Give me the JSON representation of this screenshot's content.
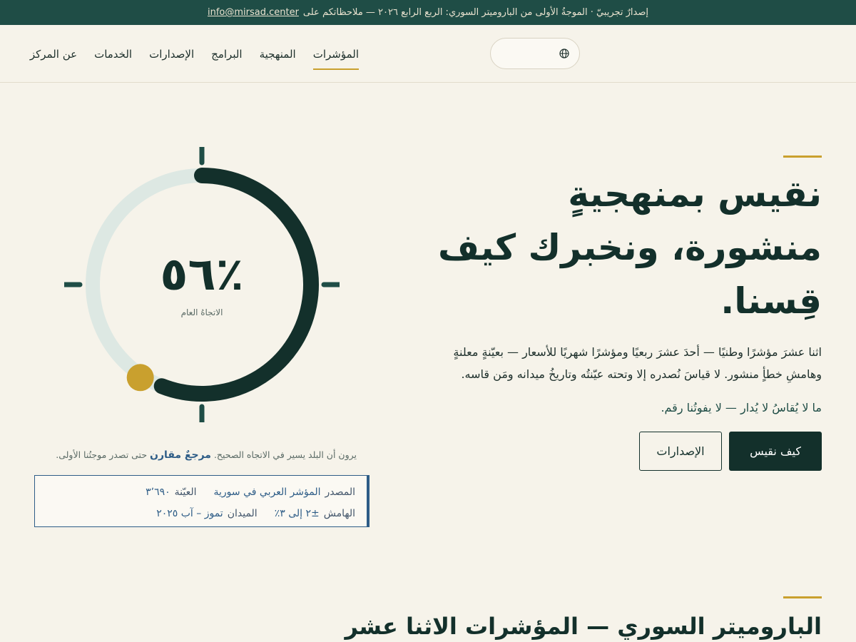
{
  "topbar": {
    "notice": "إصدارٌ تجريبيّ · الموجةُ الأولى من الباروميتر السوري: الربع الرابع ٢٠٢٦ — ملاحظاتكم على",
    "email": "info@mirsad.center"
  },
  "nav": {
    "items": [
      {
        "label": "المؤشرات",
        "active": true
      },
      {
        "label": "المنهجية"
      },
      {
        "label": "البرامج"
      },
      {
        "label": "الإصدارات"
      },
      {
        "label": "الخدمات"
      },
      {
        "label": "عن المركز"
      }
    ],
    "language_icon": "globe-icon"
  },
  "hero": {
    "title_line1": "نقيس بمنهجيةٍ",
    "title_line2": "منشورة، ونخبرك كيف",
    "title_line3": "قِسنا.",
    "paragraph_line1": "اثنا عشرَ مؤشرًا وطنيًا — أحدَ عشرَ ربعيًا ومؤشرًا شهريًا للأسعار — بعيّنةٍ معلنةٍ",
    "paragraph_line2": "وهامشِ خطأٍ منشور. لا قياسَ نُصدره إلا وتحته عيّنتُه وتاريخُ ميدانه ومَن قاسه.",
    "tagline": "ما لا يُقاسُ لا يُدار — لا يفوتُنا رقم.",
    "primary_button": "كيف نقيس",
    "secondary_button": "الإصدارات"
  },
  "gauge": {
    "value_text": "٥٦٪",
    "fraction": 0.56,
    "label": "الاتجاهُ العام",
    "colors": {
      "track": "#dde8e3",
      "progress": "#13302b",
      "marker": "#c9a02e"
    }
  },
  "caption": {
    "before": "يرون أن البلد يسير في الاتجاه الصحيح.",
    "highlight": "مرجعٌ مقارن",
    "after": "حتى تصدر موجتُنا الأولى."
  },
  "source": {
    "source_label": "المصدر",
    "source_value": "المؤشر العربي في سورية",
    "sample_label": "العيّنة",
    "sample_value": "٣٬٦٩٠",
    "margin_label": "الهامش",
    "margin_value": "±٢ إلى ٣٪",
    "field_label": "الميدان",
    "field_value": "تموز – آب ٢٠٢٥"
  },
  "section2": {
    "title": "الباروميتر السوري — المؤشرات الاثنا عشر"
  }
}
